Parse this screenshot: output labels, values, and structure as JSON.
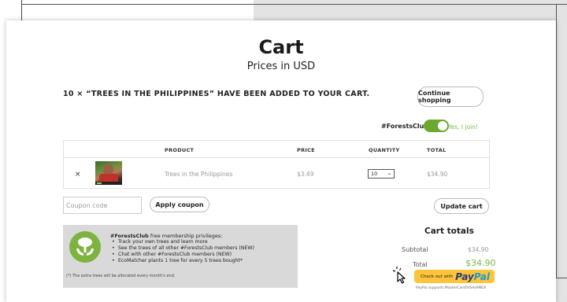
{
  "page": {
    "title": "Cart",
    "subtitle": "Prices in USD"
  },
  "notice": {
    "message": "10 × “TREES IN THE PHILIPPINES” HAVE BEEN ADDED TO YOUR CART.",
    "continue_label": "Continue shopping"
  },
  "club_toggle": {
    "label": "#ForestsClub",
    "state_text": "Yes, I join!",
    "on": true,
    "color": "#6aa82e"
  },
  "table": {
    "headers": [
      "PRODUCT",
      "PRICE",
      "QUANTITY",
      "TOTAL"
    ],
    "rows": [
      {
        "remove_glyph": "×",
        "product": "Trees in the Philippines",
        "price": "$3.49",
        "quantity": "10",
        "total": "$34.90"
      }
    ]
  },
  "coupon": {
    "placeholder": "Coupon code",
    "apply_label": "Apply coupon"
  },
  "update_label": "Update cart",
  "club_panel": {
    "heading_bold": "#ForestsClub",
    "heading_rest": " free membership privileges:",
    "items": [
      "Track your own trees and learn more",
      "See the trees of all other #ForestsClub members (NEW)",
      "Chat with other #ForestsClub members (NEW)",
      "EcoMatcher plants 1 tree for every 5 trees bought*"
    ],
    "footnote": "(*) The extra trees will be allocated every month's end."
  },
  "totals": {
    "title": "Cart totals",
    "subtotal_label": "Subtotal",
    "subtotal_value": "$34.90",
    "total_label": "Total",
    "total_value": "$34.90"
  },
  "paypal": {
    "prefix": "Check out with",
    "logo_pay": "Pay",
    "logo_pal": "Pal",
    "note": "PayPal supports MasterCard/VISA/AMEX",
    "color": "#ffc439"
  },
  "icons": {
    "remove": "close-icon",
    "quantity_dropdown": "chevron-down-icon",
    "club_logo": "tree-hands-icon",
    "pointer": "cursor-pointer-icon"
  }
}
